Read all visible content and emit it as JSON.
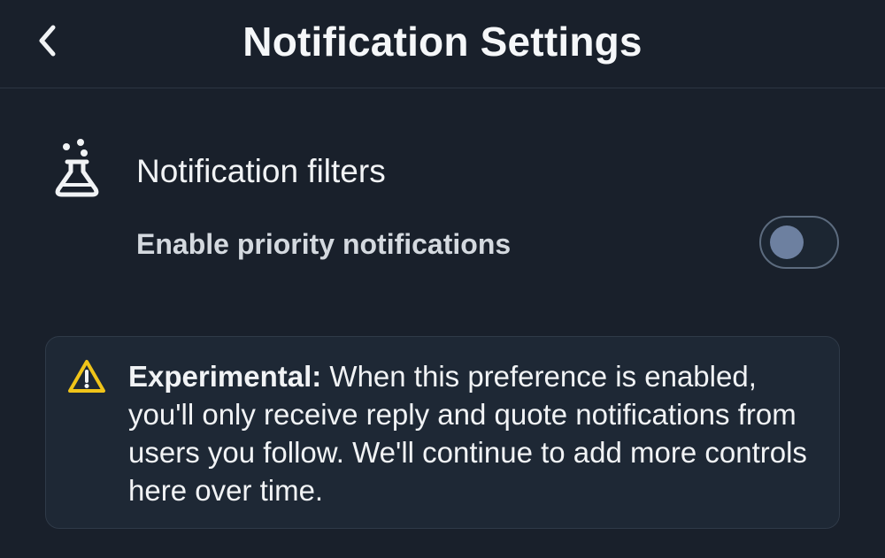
{
  "header": {
    "title": "Notification Settings",
    "back_icon": "chevron-left-icon"
  },
  "section": {
    "icon": "flask-icon",
    "title": "Notification filters"
  },
  "priority_toggle": {
    "label": "Enable priority notifications",
    "checked": false
  },
  "notice": {
    "icon": "warning-icon",
    "icon_color": "#f0c419",
    "lead": "Experimental:",
    "body": " When this preference is enabled, you'll only receive reply and quote notifications from users you follow. We'll continue to add more controls here over time."
  },
  "colors": {
    "background": "#19202b",
    "panel": "#1e2835",
    "toggle_knob": "#6d80a0",
    "text": "#f1f3f5"
  }
}
